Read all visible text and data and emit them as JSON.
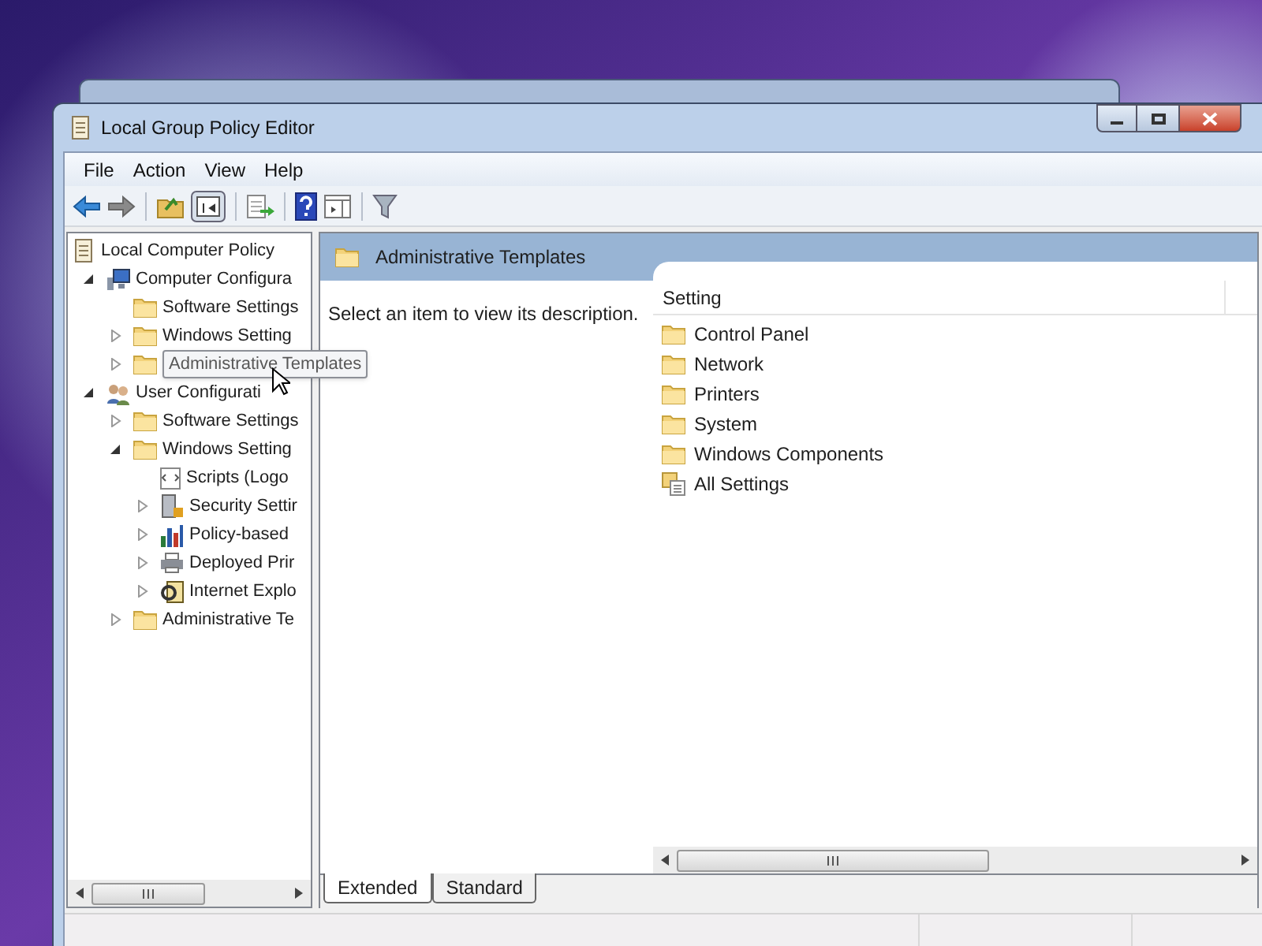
{
  "window": {
    "title": "Local Group Policy Editor"
  },
  "menu": [
    "File",
    "Action",
    "View",
    "Help"
  ],
  "tree": {
    "root": "Local Computer Policy",
    "items": [
      {
        "label": "Computer Configura",
        "kind": "computer",
        "expanded": true,
        "children": [
          {
            "label": "Software Settings",
            "kind": "folder"
          },
          {
            "label": "Windows Setting",
            "kind": "folder",
            "expanded": false
          },
          {
            "tooltip": "Administrative Templates",
            "kind": "folder",
            "expanded": false
          }
        ]
      },
      {
        "label": "User Configurati",
        "kind": "user",
        "expanded": true,
        "children": [
          {
            "label": "Software Settings",
            "kind": "folder",
            "expanded": false
          },
          {
            "label": "Windows Setting",
            "kind": "folder",
            "expanded": true,
            "children": [
              {
                "label": "Scripts (Logo",
                "kind": "script"
              },
              {
                "label": "Security Settir",
                "kind": "security",
                "expanded": false
              },
              {
                "label": "Policy-based",
                "kind": "chart",
                "expanded": false
              },
              {
                "label": "Deployed Prir",
                "kind": "printer",
                "expanded": false
              },
              {
                "label": "Internet Explo",
                "kind": "browser",
                "expanded": false
              }
            ]
          },
          {
            "label": "Administrative Te",
            "kind": "folder",
            "expanded": false
          }
        ]
      }
    ]
  },
  "details": {
    "title": "Administrative Templates",
    "description": "Select an item to view its description.",
    "column": "Setting",
    "rows": [
      {
        "label": "Control Panel",
        "kind": "folder"
      },
      {
        "label": "Network",
        "kind": "folder"
      },
      {
        "label": "Printers",
        "kind": "folder"
      },
      {
        "label": "System",
        "kind": "folder"
      },
      {
        "label": "Windows Components",
        "kind": "folder"
      },
      {
        "label": "All Settings",
        "kind": "settings-list"
      }
    ]
  },
  "tabs": [
    {
      "label": "Extended",
      "selected": true
    },
    {
      "label": "Standard",
      "selected": false
    }
  ]
}
